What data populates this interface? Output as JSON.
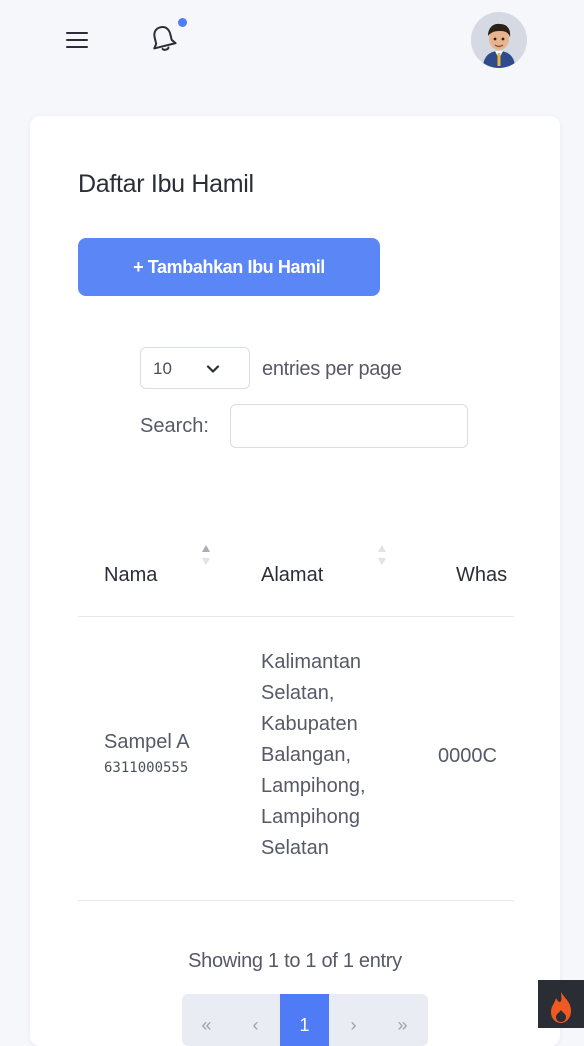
{
  "topbar": {
    "menu_icon": "hamburger-icon",
    "notification_icon": "bell-icon",
    "notification_badge_color": "#4f7bf7",
    "avatar_icon": "user-avatar"
  },
  "card": {
    "title": "Daftar Ibu Hamil",
    "add_button_label": "+ Tambahkan Ibu Hamil",
    "accent_color": "#5b86f5"
  },
  "table_controls": {
    "per_page_value": "10",
    "per_page_label": "entries per page",
    "search_label": "Search:",
    "search_value": ""
  },
  "table": {
    "columns": [
      "Nama",
      "Alamat",
      "Whas"
    ],
    "rows": [
      {
        "nama": "Sampel A",
        "nik": "6311000555",
        "alamat_lines": [
          "Kalimantan",
          "Selatan,",
          "Kabupaten",
          "Balangan,",
          "Lampihong,",
          "Lampihong",
          "Selatan"
        ],
        "whatsapp": "0000C"
      }
    ]
  },
  "footer": {
    "showing_text": "Showing 1 to 1 of 1 entry",
    "pagination": [
      "«",
      "‹",
      "1",
      "›",
      "»"
    ],
    "active_page": "1"
  },
  "corner_icon": "fire-icon"
}
